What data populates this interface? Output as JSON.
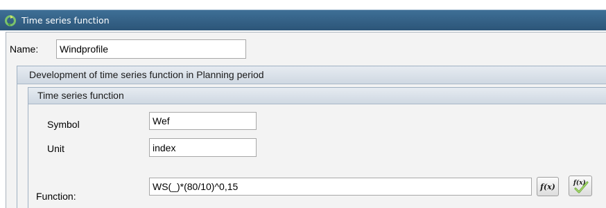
{
  "window": {
    "title": "Time series function",
    "icon": "recycle-arrows-icon"
  },
  "name": {
    "label": "Name:",
    "value": "Windprofile"
  },
  "development_group": {
    "title": "Development of time series function in Planning period"
  },
  "function_group": {
    "title": "Time series function",
    "symbol_label": "Symbol",
    "symbol_value": "Wef",
    "unit_label": "Unit",
    "unit_value": "index",
    "function_label": "Function:",
    "function_value": "WS(_)*(80/10)^0,15"
  },
  "toolbar": {
    "fx_label": "f(x)",
    "fx_icon": "function-fx-icon",
    "fx_check_label": "f(x)",
    "fx_check_icon": "function-validate-check-icon"
  },
  "colors": {
    "titlebar": "#2c5578",
    "group_header": "#d7dfe8",
    "panel": "#f3f3f3"
  }
}
